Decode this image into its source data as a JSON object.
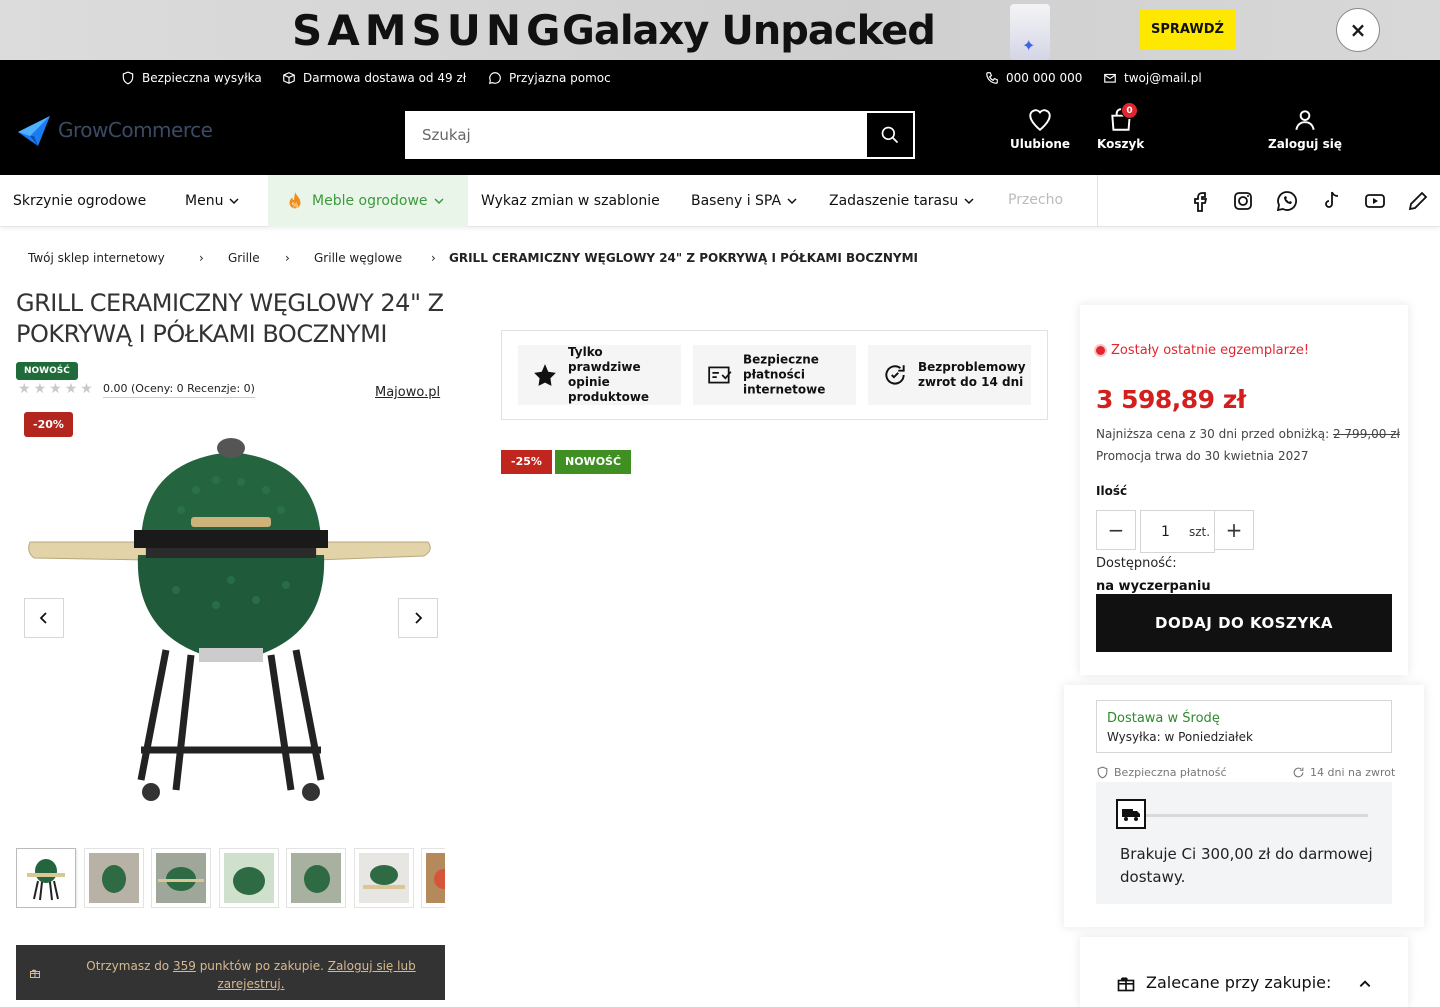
{
  "ad": {
    "brand": "SAMSUNG",
    "headline": "Galaxy Unpacked",
    "cta": "SPRAWDŹ",
    "close": "×"
  },
  "topbar": {
    "info1": "Bezpieczna wysyłka",
    "info2": "Darmowa dostawa od 49 zł",
    "info3": "Przyjazna pomoc",
    "phone": "000 000 000",
    "email": "twoj@mail.pl"
  },
  "header": {
    "logo": "GrowCommerce",
    "search_placeholder": "Szukaj",
    "wishlist": "Ulubione",
    "cart": "Koszyk",
    "cart_count": "0",
    "login": "Zaloguj się"
  },
  "nav": {
    "items": [
      "Skrzynie ogrodowe",
      "Menu",
      "Meble ogrodowe",
      "Wykaz zmian w szablonie",
      "Baseny i SPA",
      "Zadaszenie tarasu",
      "Przecho"
    ]
  },
  "breadcrumb": [
    "Twój sklep internetowy",
    "Grille",
    "Grille węglowe",
    "GRILL CERAMICZNY WĘGLOWY 24\" Z POKRYWĄ I PÓŁKAMI BOCZNYMI"
  ],
  "product": {
    "title": "GRILL CERAMICZNY WĘGLOWY 24\" Z POKRYWĄ I PÓŁKAMI BOCZNYMI",
    "new_tag": "NOWOŚĆ",
    "rating_value": "0.00",
    "rating_text": "(Oceny: 0 Recenzje: 0)",
    "stars": 0,
    "vendor": "Majowo.pl",
    "discount_badge": "-20%",
    "points_pre": "Otrzymasz do ",
    "points_value": "359",
    "points_mid": " punktów po zakupie. ",
    "points_link": "Zaloguj się lub zarejestruj."
  },
  "perks": [
    {
      "icon": "star-icon",
      "text": "Tylko prawdziwe opinie produktowe"
    },
    {
      "icon": "secure-payment-icon",
      "text": "Bezpieczne płatności internetowe"
    },
    {
      "icon": "return-icon",
      "text": "Bezproblemowy zwrot do 14 dni"
    }
  ],
  "middle_tags": {
    "discount": "-25%",
    "new": "NOWOŚĆ"
  },
  "buy": {
    "stock": "Zostały ostatnie egzemplarze!",
    "price": "3 598,89 zł",
    "lowest_label": "Najniższa cena z 30 dni przed obniżką: ",
    "lowest_price": "2 799,00 zł",
    "promo": "Promocja trwa do 30 kwietnia 2027",
    "qty_label": "Ilość",
    "qty_value": "1",
    "qty_unit": "szt.",
    "minus": "−",
    "plus": "+",
    "avail_label": "Dostępność:",
    "avail_value": "na wyczerpaniu",
    "add_to_cart": "DODAJ DO KOSZYKA"
  },
  "shipping": {
    "delivery": "Dostawa w Środę",
    "dispatch": "Wysyłka: w Poniedziałek",
    "secure": "Bezpieczna płatność",
    "returns": "14 dni na zwrot",
    "free_shipping": "Brakuje Ci 300,00 zł do darmowej dostawy.",
    "free_shipping_progress": 0
  },
  "recommended": {
    "title": "Zalecane przy zakupie:"
  },
  "colors": {
    "accent_red": "#d3201f",
    "new_green": "#1f6b3a",
    "nav_active": "#3b9a3b",
    "points_bg": "#333333"
  }
}
